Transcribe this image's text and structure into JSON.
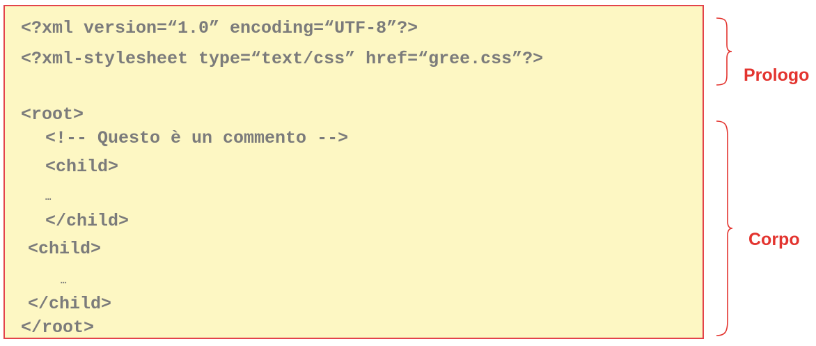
{
  "code": {
    "lines": [
      "<?xml version=“1.0” encoding=“UTF-8”?>",
      "<?xml-stylesheet type=“text/css” href=“gree.css”?>",
      "<root>",
      "<!-- Questo è un commento -->",
      "<child>",
      "…",
      "</child>",
      "<child>",
      "…",
      "</child>",
      "</root>"
    ]
  },
  "sections": {
    "prologo": {
      "label": "Prologo"
    },
    "corpo": {
      "label": "Corpo"
    }
  },
  "colors": {
    "accent": "#e3342f",
    "box_fill": "#fdf7c3",
    "code_text": "#7b7b7b"
  }
}
